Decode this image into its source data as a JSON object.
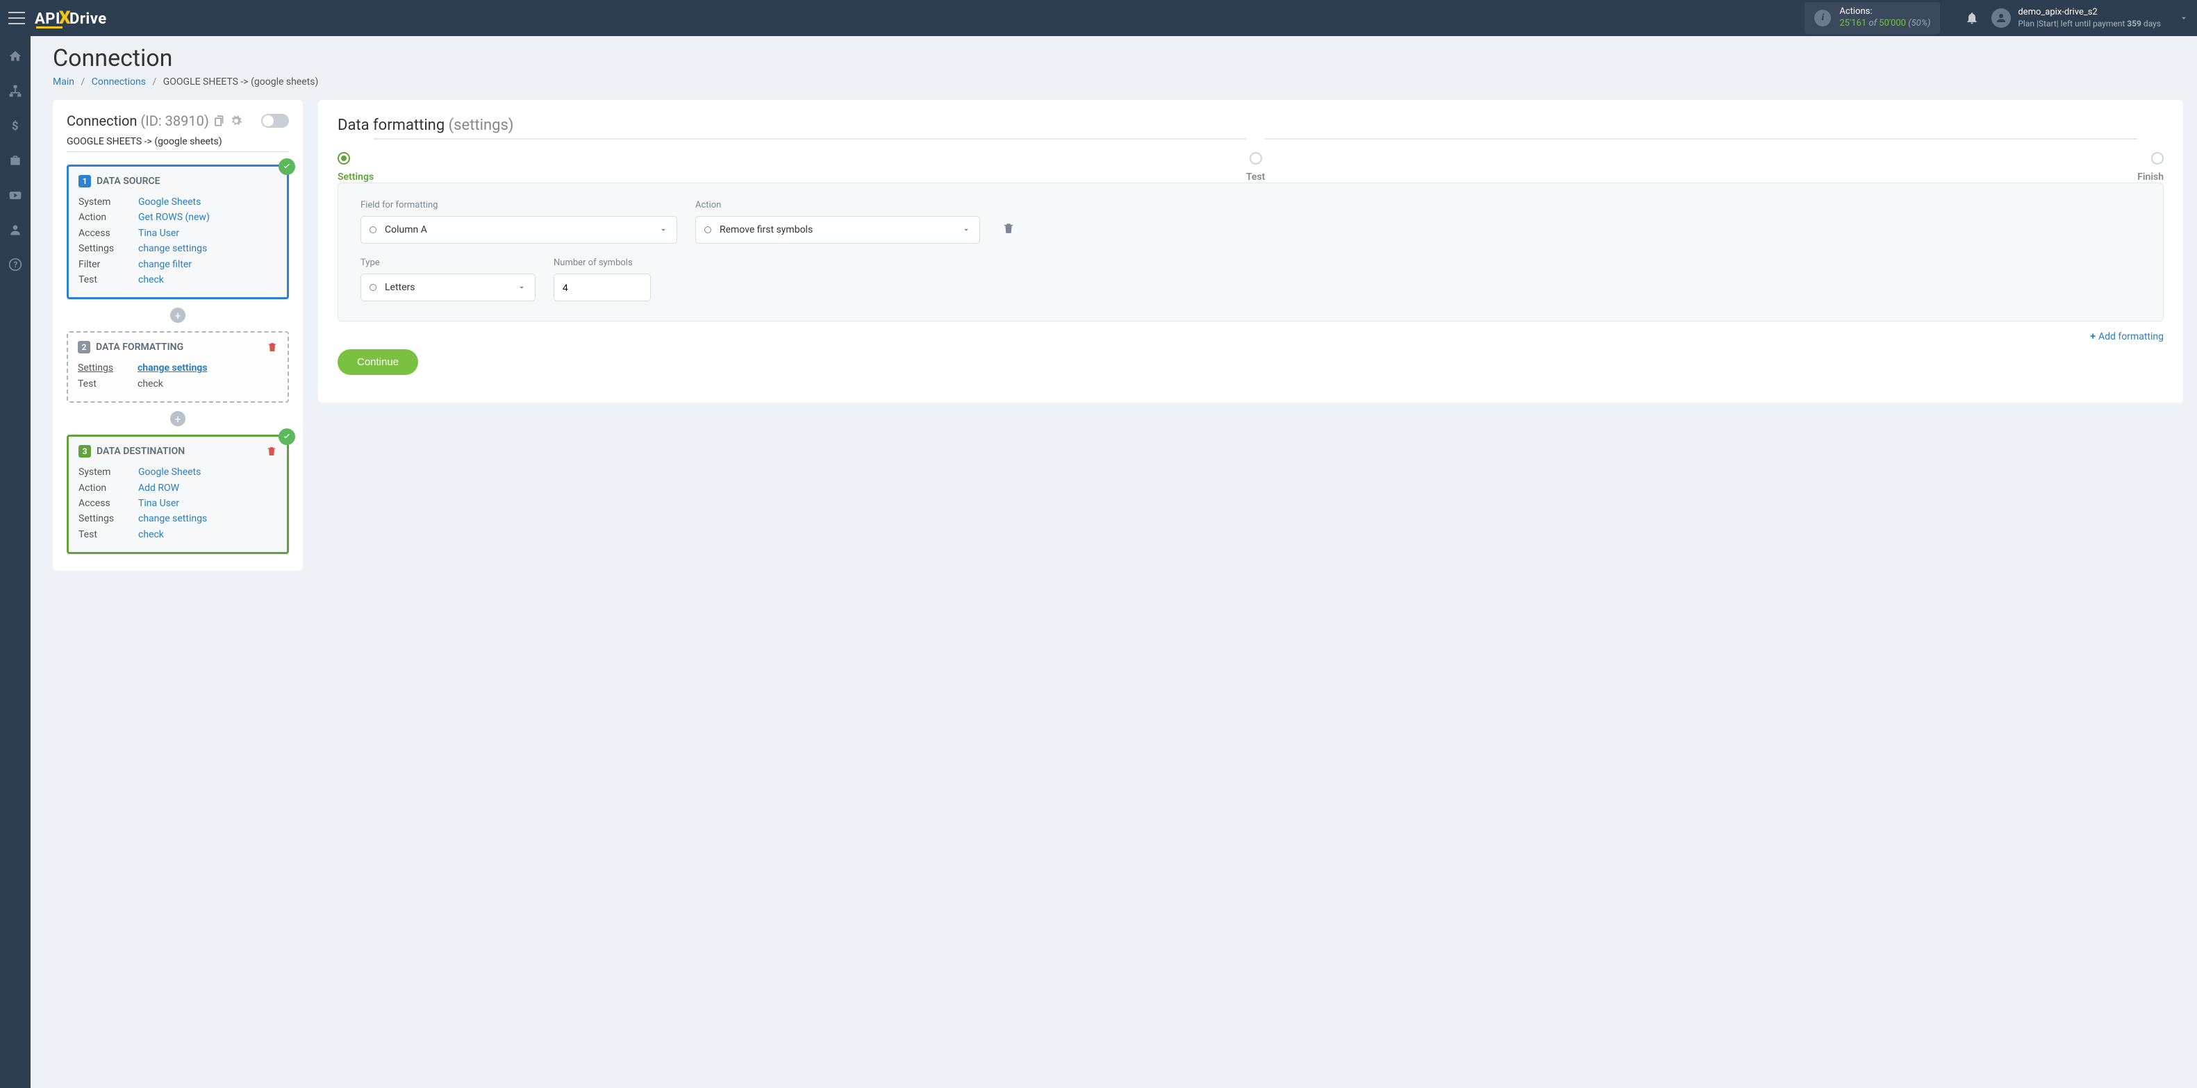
{
  "header": {
    "logo_api": "API",
    "logo_drive": "Drive",
    "actions_label": "Actions:",
    "actions_used": "25'161",
    "actions_of": "of",
    "actions_total": "50'000",
    "actions_pct": "(50%)",
    "username": "demo_apix-drive_s2",
    "plan_prefix": "Plan |Start| left until payment",
    "plan_days": "359",
    "plan_days_suffix": "days"
  },
  "page": {
    "title": "Connection",
    "breadcrumb": {
      "main": "Main",
      "connections": "Connections",
      "current": "GOOGLE SHEETS -> (google sheets)"
    }
  },
  "left": {
    "title": "Connection",
    "id_label": "(ID: 38910)",
    "subtitle": "GOOGLE SHEETS -> (google sheets)",
    "card1": {
      "num": "1",
      "title": "DATA SOURCE",
      "rows": {
        "system_k": "System",
        "system_v": "Google Sheets",
        "action_k": "Action",
        "action_v": "Get ROWS (new)",
        "access_k": "Access",
        "access_v": "Tina User",
        "settings_k": "Settings",
        "settings_v": "change settings",
        "filter_k": "Filter",
        "filter_v": "change filter",
        "test_k": "Test",
        "test_v": "check"
      }
    },
    "card2": {
      "num": "2",
      "title": "DATA FORMATTING",
      "rows": {
        "settings_k": "Settings",
        "settings_v": "change settings",
        "test_k": "Test",
        "test_v": "check"
      }
    },
    "card3": {
      "num": "3",
      "title": "DATA DESTINATION",
      "rows": {
        "system_k": "System",
        "system_v": "Google Sheets",
        "action_k": "Action",
        "action_v": "Add ROW",
        "access_k": "Access",
        "access_v": "Tina User",
        "settings_k": "Settings",
        "settings_v": "change settings",
        "test_k": "Test",
        "test_v": "check"
      }
    }
  },
  "right": {
    "title": "Data formatting",
    "title_sub": "(settings)",
    "steps": {
      "s1": "Settings",
      "s2": "Test",
      "s3": "Finish"
    },
    "form": {
      "field_label": "Field for formatting",
      "field_value": "Column A",
      "action_label": "Action",
      "action_value": "Remove first symbols",
      "type_label": "Type",
      "type_value": "Letters",
      "num_label": "Number of symbols",
      "num_value": "4"
    },
    "add_formatting": "Add formatting",
    "continue": "Continue"
  }
}
